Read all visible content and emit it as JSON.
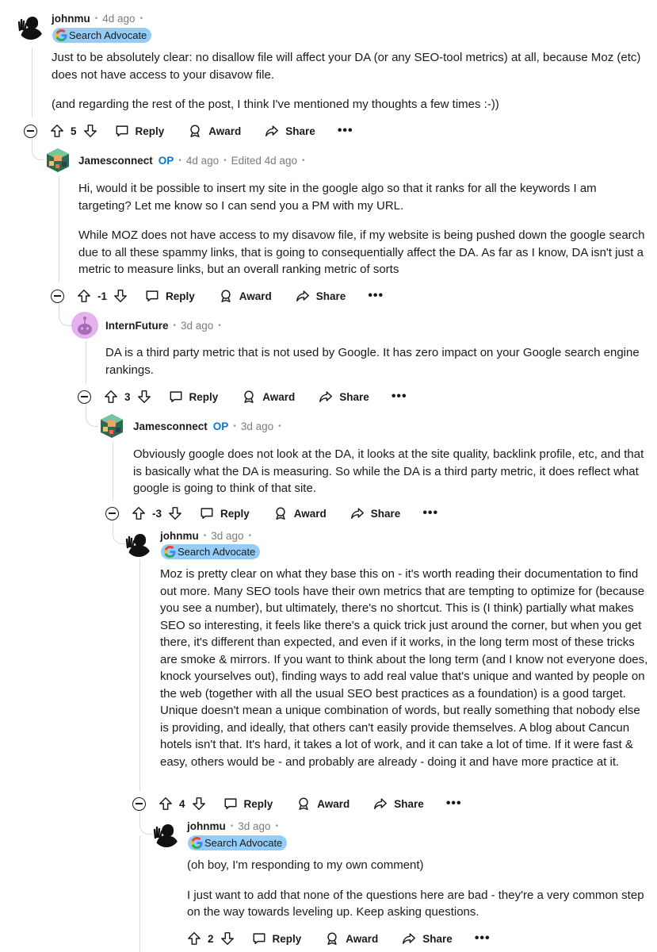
{
  "labels": {
    "reply": "Reply",
    "award": "Award",
    "share": "Share",
    "more": "•••",
    "op": "OP",
    "sep": "•"
  },
  "comments": [
    {
      "author": "johnmu",
      "time": "4d ago",
      "flair": "Search Advocate",
      "body": [
        "Just to be absolutely clear: no disallow file will affect your DA (or any SEO-tool metrics) at all, because Moz (etc) does not have access to your disavow file.",
        "(and regarding the rest of the post, I think I've mentioned my thoughts a few times :-))"
      ],
      "score": "5"
    },
    {
      "author": "Jamesconnect",
      "op": true,
      "time": "4d ago",
      "edited": "Edited 4d ago",
      "body": [
        "Hi, would it be possible to insert my site in the google algo so that it ranks for all the keywords I am targeting? Let me know so I can send you a PM with my URL.",
        "While MOZ does not have access to my disavow file, if my website is being pushed down the google search due to all these spammy links, that is going to consequentially affect the DA. As far as I know, DA isn't just a metric to measure links, but an overall ranking metric of sorts"
      ],
      "score": "-1"
    },
    {
      "author": "InternFuture",
      "time": "3d ago",
      "body": [
        "DA is a third party metric that is not used by Google. It has zero impact on your Google search engine rankings."
      ],
      "score": "3"
    },
    {
      "author": "Jamesconnect",
      "op": true,
      "time": "3d ago",
      "body": [
        "Obviously google does not look at the DA, it looks at the site quality, backlink profile, etc, and that is basically what the DA is measuring. So while the DA is a third party metric, it does reflect what google is going to think of that site."
      ],
      "score": "-3"
    },
    {
      "author": "johnmu",
      "time": "3d ago",
      "flair": "Search Advocate",
      "body": [
        "Moz is pretty clear on what they base this on - it's worth reading their documentation to find out more. Many SEO tools have their own metrics that are tempting to optimize for (because you see a number), but ultimately, there's no shortcut. This is (I think) partially what makes SEO so interesting, it feels like there's a quick trick just around the corner, but when you get there, it's different than expected, and even if it works, in the long term most of these tricks are smoke & mirrors. If you want to think about the long term (and I know not everyone does, knock yourselves out), finding ways to add real value that's unique and wanted by people on the web (together with all the usual SEO best practices as a foundation) is a good target. Unique doesn't mean a unique combination of words, but really something that nobody else is providing, and ideally, that others can't easily provide themselves. A blog about Cancun hotels isn't that. It's hard, it takes a lot of work, and it can take a lot of time. If it were fast & easy, others would be - and probably are already - doing it and have more practice at it."
      ],
      "score": "4"
    },
    {
      "author": "johnmu",
      "time": "3d ago",
      "flair": "Search Advocate",
      "body": [
        "(oh boy, I'm responding to my own comment)",
        "I just want to add that none of the questions here are bad - they're a very common step on the way towards leveling up. Keep asking questions."
      ],
      "score": "2"
    }
  ]
}
